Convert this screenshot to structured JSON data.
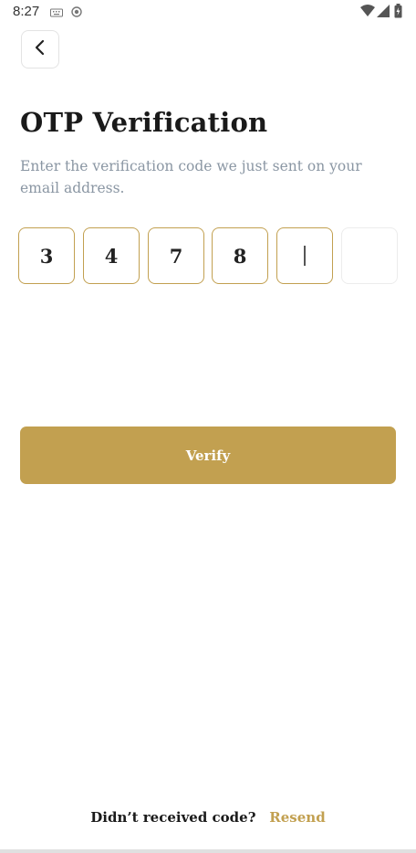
{
  "status_bar": {
    "time": "8:27"
  },
  "header": {
    "back_icon": "chevron-left-icon"
  },
  "title": "OTP Verification",
  "subtitle": "Enter the verification code we just sent on your email address.",
  "otp": {
    "digits": [
      "3",
      "4",
      "7",
      "8",
      "",
      ""
    ],
    "focused_index": 4
  },
  "verify_label": "Verify",
  "footer": {
    "prompt": "Didn’t received code?",
    "resend_label": "Resend"
  },
  "colors": {
    "accent": "#c2a050",
    "subtitle": "#8a96a3",
    "text": "#1a1a1a"
  }
}
